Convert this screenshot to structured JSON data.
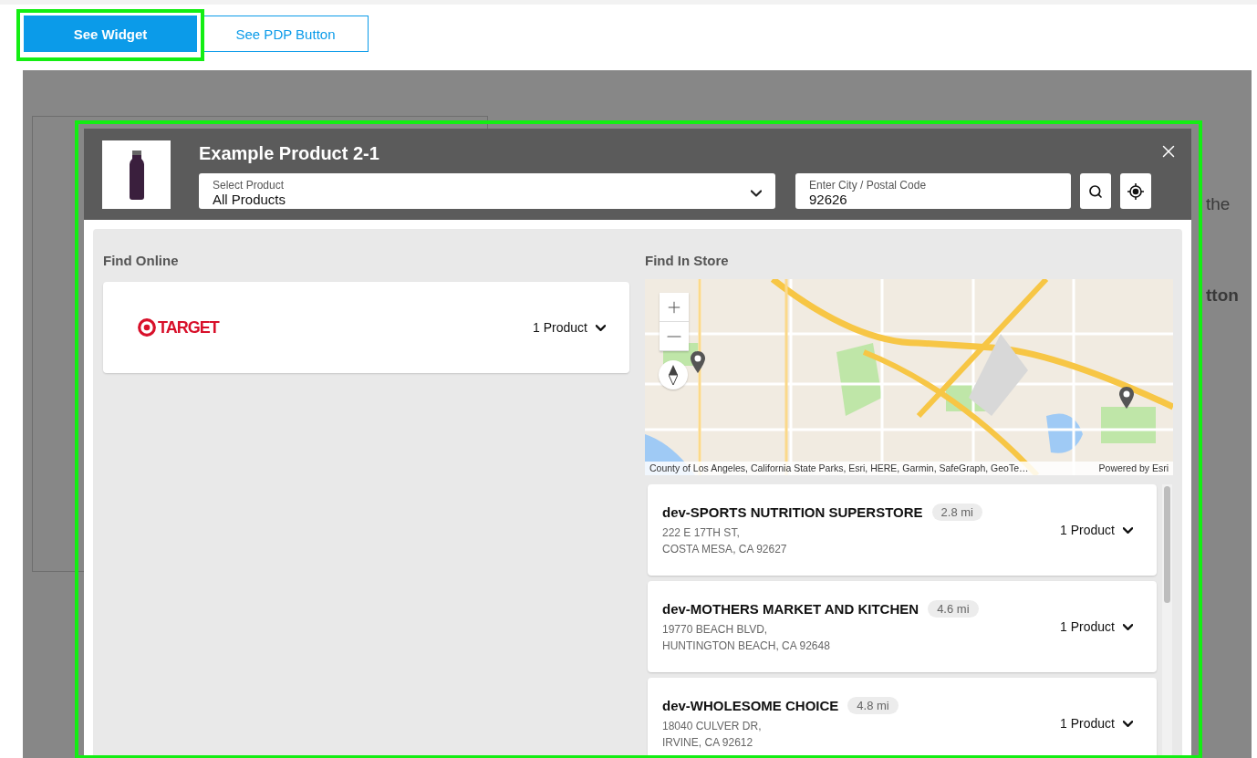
{
  "toolbar": {
    "buttons": [
      {
        "label": "See Widget",
        "selected": true
      },
      {
        "label": "See PDP Button",
        "selected": false
      }
    ]
  },
  "background_fragments": [
    {
      "text": "the",
      "kind": "body"
    },
    {
      "text": "tton",
      "kind": "heading"
    }
  ],
  "modal": {
    "title": "Example Product 2-1",
    "product_select": {
      "label": "Select Product",
      "value": "All Products"
    },
    "location_field": {
      "label": "Enter City / Postal Code",
      "value": "92626"
    },
    "find_online": {
      "heading": "Find Online",
      "retailers": [
        {
          "name": "TARGET",
          "products": "1 Product"
        }
      ]
    },
    "find_in_store": {
      "heading": "Find In Store",
      "map": {
        "attribution": "County of Los Angeles, California State Parks, Esri, HERE, Garmin, SafeGraph, GeoTe…",
        "credit": "Powered by Esri"
      },
      "stores": [
        {
          "name": "dev-SPORTS NUTRITION SUPERSTORE",
          "distance": "2.8 mi",
          "address": [
            "222 E 17TH ST,",
            "COSTA MESA, CA 92627"
          ],
          "products": "1 Product"
        },
        {
          "name": "dev-MOTHERS MARKET AND KITCHEN",
          "distance": "4.6 mi",
          "address": [
            "19770 BEACH BLVD,",
            "HUNTINGTON BEACH, CA 92648"
          ],
          "products": "1 Product"
        },
        {
          "name": "dev-WHOLESOME CHOICE",
          "distance": "4.8 mi",
          "address": [
            "18040 CULVER DR,",
            "IRVINE, CA 92612"
          ],
          "products": "1 Product"
        }
      ]
    }
  }
}
